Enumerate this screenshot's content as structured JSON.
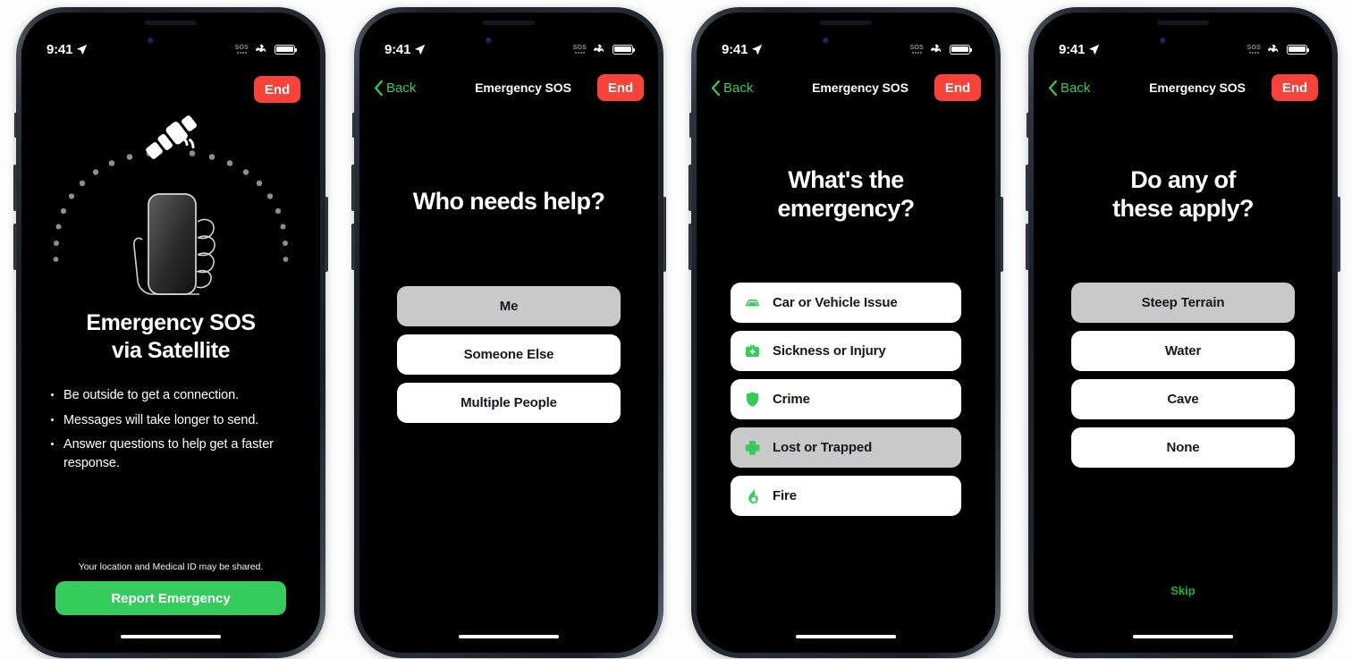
{
  "accent": {
    "green": "#35cc5e",
    "nav_green": "#2ece4f",
    "red": "#fa4238",
    "selected_gray": "#c9c9c9",
    "skip_green": "#19b33b"
  },
  "status_bar": {
    "time": "9:41",
    "location_icon": "location-arrow-icon",
    "sos_label": "SOS",
    "satellite_icon": "satellite-icon",
    "battery_icon": "battery-full-icon"
  },
  "screens": [
    {
      "id": "intro",
      "nav": {
        "has_back": false,
        "title": "",
        "end_label": "End"
      },
      "hero_icon": "satellite-connection-illustration",
      "title_line1": "Emergency SOS",
      "title_line2": "via Satellite",
      "bullets": [
        "Be outside to get a connection.",
        "Messages will take longer to send.",
        "Answer questions to help get a faster response."
      ],
      "disclaimer": "Your location and Medical ID may be shared.",
      "cta_label": "Report Emergency"
    },
    {
      "id": "who-needs-help",
      "nav": {
        "has_back": true,
        "back_label": "Back",
        "title": "Emergency SOS",
        "end_label": "End"
      },
      "question": "Who needs help?",
      "options": [
        {
          "label": "Me",
          "selected": true,
          "icon": null
        },
        {
          "label": "Someone Else",
          "selected": false,
          "icon": null
        },
        {
          "label": "Multiple People",
          "selected": false,
          "icon": null
        }
      ]
    },
    {
      "id": "whats-the-emergency",
      "nav": {
        "has_back": true,
        "back_label": "Back",
        "title": "Emergency SOS",
        "end_label": "End"
      },
      "question_line1": "What's the",
      "question_line2": "emergency?",
      "options": [
        {
          "label": "Car or Vehicle Issue",
          "selected": false,
          "icon": "car-icon"
        },
        {
          "label": "Sickness or Injury",
          "selected": false,
          "icon": "medical-bag-icon"
        },
        {
          "label": "Crime",
          "selected": false,
          "icon": "shield-icon"
        },
        {
          "label": "Lost or Trapped",
          "selected": true,
          "icon": "cross-icon"
        },
        {
          "label": "Fire",
          "selected": false,
          "icon": "flame-icon"
        }
      ]
    },
    {
      "id": "do-any-of-these-apply",
      "nav": {
        "has_back": true,
        "back_label": "Back",
        "title": "Emergency SOS",
        "end_label": "End"
      },
      "question_line1": "Do any of",
      "question_line2": "these apply?",
      "options": [
        {
          "label": "Steep Terrain",
          "selected": true,
          "icon": null
        },
        {
          "label": "Water",
          "selected": false,
          "icon": null
        },
        {
          "label": "Cave",
          "selected": false,
          "icon": null
        },
        {
          "label": "None",
          "selected": false,
          "icon": null
        }
      ],
      "skip_label": "Skip"
    }
  ]
}
